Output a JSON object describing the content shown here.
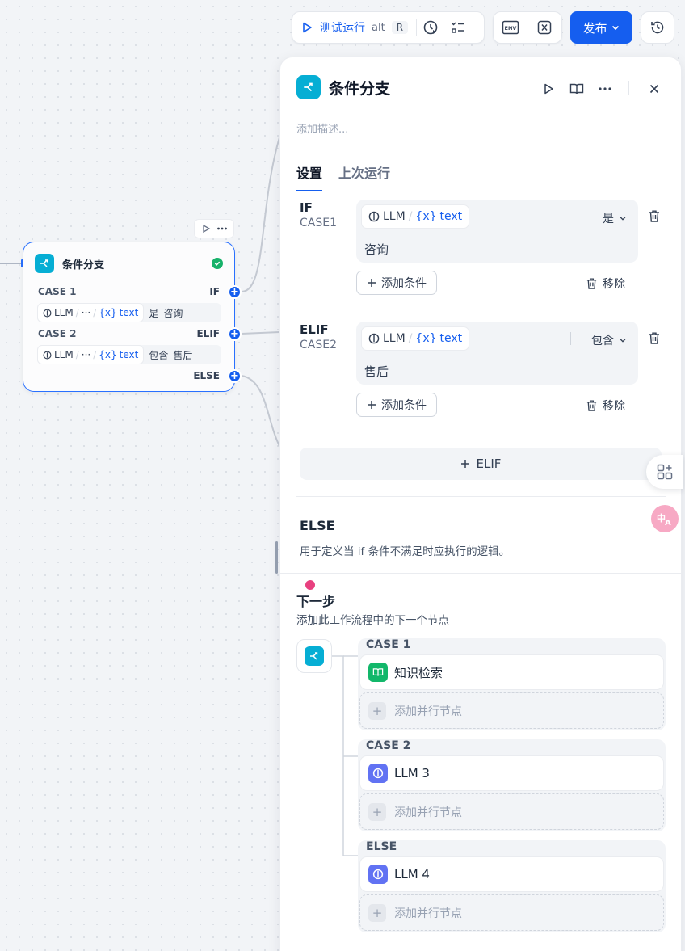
{
  "toolbar": {
    "run_label": "测试运行",
    "shortcut_mod": "alt",
    "shortcut_key": "R",
    "env_icon": "env-icon",
    "variable_icon": "variable-icon",
    "publish_label": "发布"
  },
  "canvas_node": {
    "title": "条件分支",
    "case1_name": "CASE 1",
    "case1_kind": "IF",
    "case1_source": "LLM",
    "case1_ellipsis": "···",
    "case1_var": "text",
    "case1_op": "是",
    "case1_value": "咨询",
    "case2_name": "CASE 2",
    "case2_kind": "ELIF",
    "case2_source": "LLM",
    "case2_ellipsis": "···",
    "case2_var": "text",
    "case2_op": "包含",
    "case2_value": "售后",
    "else_label": "ELSE",
    "var_prefix": "{x}"
  },
  "panel": {
    "title": "条件分支",
    "description_placeholder": "添加描述...",
    "tabs": [
      {
        "label": "设置"
      },
      {
        "label": "上次运行"
      }
    ],
    "cases": [
      {
        "kind": "IF",
        "name": "CASE1",
        "source": "LLM",
        "var_prefix": "{x}",
        "var": "text",
        "operator": "是",
        "value": "咨询",
        "add_condition": "添加条件",
        "remove": "移除"
      },
      {
        "kind": "ELIF",
        "name": "CASE2",
        "source": "LLM",
        "var_prefix": "{x}",
        "var": "text",
        "operator": "包含",
        "value": "售后",
        "add_condition": "添加条件",
        "remove": "移除"
      }
    ],
    "add_elif": "ELIF",
    "else_title": "ELSE",
    "else_desc": "用于定义当 if 条件不满足时应执行的逻辑。",
    "next_title": "下一步",
    "next_desc": "添加此工作流程中的下一个节点",
    "branches": [
      {
        "label": "CASE 1",
        "node": "知识检索",
        "icon": "book-icon",
        "color": "#12b76a",
        "add_parallel": "添加并行节点"
      },
      {
        "label": "CASE 2",
        "node": "LLM 3",
        "icon": "llm-icon",
        "color": "#6172f3",
        "add_parallel": "添加并行节点"
      },
      {
        "label": "ELSE",
        "node": "LLM 4",
        "icon": "llm-icon",
        "color": "#6172f3",
        "add_parallel": "添加并行节点"
      }
    ]
  },
  "colors": {
    "accent": "#155eef",
    "branch_icon": "#06aed4",
    "success": "#17b26a"
  }
}
